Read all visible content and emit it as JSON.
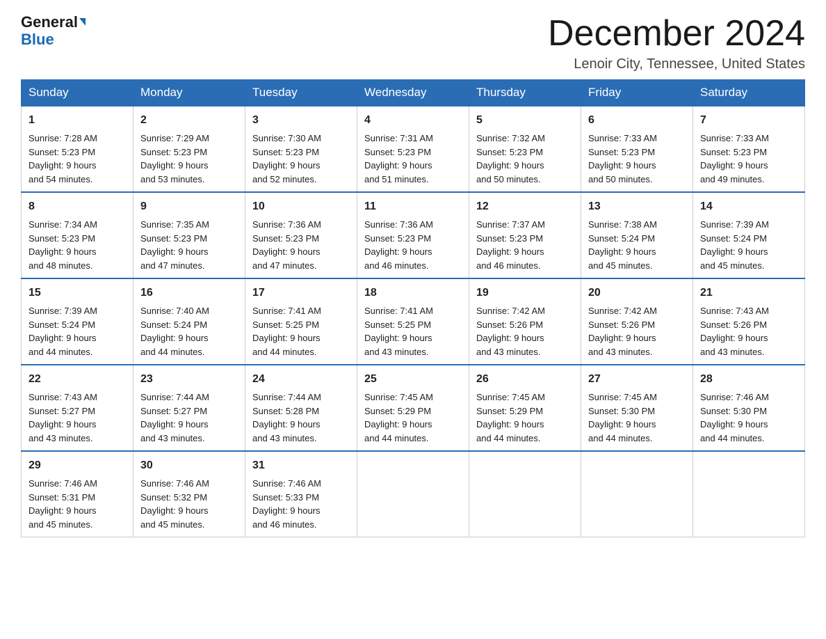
{
  "header": {
    "logo_line1": "General",
    "logo_line2": "Blue",
    "month_title": "December 2024",
    "location": "Lenoir City, Tennessee, United States"
  },
  "weekdays": [
    "Sunday",
    "Monday",
    "Tuesday",
    "Wednesday",
    "Thursday",
    "Friday",
    "Saturday"
  ],
  "weeks": [
    [
      {
        "day": "1",
        "sunrise": "7:28 AM",
        "sunset": "5:23 PM",
        "daylight": "9 hours and 54 minutes."
      },
      {
        "day": "2",
        "sunrise": "7:29 AM",
        "sunset": "5:23 PM",
        "daylight": "9 hours and 53 minutes."
      },
      {
        "day": "3",
        "sunrise": "7:30 AM",
        "sunset": "5:23 PM",
        "daylight": "9 hours and 52 minutes."
      },
      {
        "day": "4",
        "sunrise": "7:31 AM",
        "sunset": "5:23 PM",
        "daylight": "9 hours and 51 minutes."
      },
      {
        "day": "5",
        "sunrise": "7:32 AM",
        "sunset": "5:23 PM",
        "daylight": "9 hours and 50 minutes."
      },
      {
        "day": "6",
        "sunrise": "7:33 AM",
        "sunset": "5:23 PM",
        "daylight": "9 hours and 50 minutes."
      },
      {
        "day": "7",
        "sunrise": "7:33 AM",
        "sunset": "5:23 PM",
        "daylight": "9 hours and 49 minutes."
      }
    ],
    [
      {
        "day": "8",
        "sunrise": "7:34 AM",
        "sunset": "5:23 PM",
        "daylight": "9 hours and 48 minutes."
      },
      {
        "day": "9",
        "sunrise": "7:35 AM",
        "sunset": "5:23 PM",
        "daylight": "9 hours and 47 minutes."
      },
      {
        "day": "10",
        "sunrise": "7:36 AM",
        "sunset": "5:23 PM",
        "daylight": "9 hours and 47 minutes."
      },
      {
        "day": "11",
        "sunrise": "7:36 AM",
        "sunset": "5:23 PM",
        "daylight": "9 hours and 46 minutes."
      },
      {
        "day": "12",
        "sunrise": "7:37 AM",
        "sunset": "5:23 PM",
        "daylight": "9 hours and 46 minutes."
      },
      {
        "day": "13",
        "sunrise": "7:38 AM",
        "sunset": "5:24 PM",
        "daylight": "9 hours and 45 minutes."
      },
      {
        "day": "14",
        "sunrise": "7:39 AM",
        "sunset": "5:24 PM",
        "daylight": "9 hours and 45 minutes."
      }
    ],
    [
      {
        "day": "15",
        "sunrise": "7:39 AM",
        "sunset": "5:24 PM",
        "daylight": "9 hours and 44 minutes."
      },
      {
        "day": "16",
        "sunrise": "7:40 AM",
        "sunset": "5:24 PM",
        "daylight": "9 hours and 44 minutes."
      },
      {
        "day": "17",
        "sunrise": "7:41 AM",
        "sunset": "5:25 PM",
        "daylight": "9 hours and 44 minutes."
      },
      {
        "day": "18",
        "sunrise": "7:41 AM",
        "sunset": "5:25 PM",
        "daylight": "9 hours and 43 minutes."
      },
      {
        "day": "19",
        "sunrise": "7:42 AM",
        "sunset": "5:26 PM",
        "daylight": "9 hours and 43 minutes."
      },
      {
        "day": "20",
        "sunrise": "7:42 AM",
        "sunset": "5:26 PM",
        "daylight": "9 hours and 43 minutes."
      },
      {
        "day": "21",
        "sunrise": "7:43 AM",
        "sunset": "5:26 PM",
        "daylight": "9 hours and 43 minutes."
      }
    ],
    [
      {
        "day": "22",
        "sunrise": "7:43 AM",
        "sunset": "5:27 PM",
        "daylight": "9 hours and 43 minutes."
      },
      {
        "day": "23",
        "sunrise": "7:44 AM",
        "sunset": "5:27 PM",
        "daylight": "9 hours and 43 minutes."
      },
      {
        "day": "24",
        "sunrise": "7:44 AM",
        "sunset": "5:28 PM",
        "daylight": "9 hours and 43 minutes."
      },
      {
        "day": "25",
        "sunrise": "7:45 AM",
        "sunset": "5:29 PM",
        "daylight": "9 hours and 44 minutes."
      },
      {
        "day": "26",
        "sunrise": "7:45 AM",
        "sunset": "5:29 PM",
        "daylight": "9 hours and 44 minutes."
      },
      {
        "day": "27",
        "sunrise": "7:45 AM",
        "sunset": "5:30 PM",
        "daylight": "9 hours and 44 minutes."
      },
      {
        "day": "28",
        "sunrise": "7:46 AM",
        "sunset": "5:30 PM",
        "daylight": "9 hours and 44 minutes."
      }
    ],
    [
      {
        "day": "29",
        "sunrise": "7:46 AM",
        "sunset": "5:31 PM",
        "daylight": "9 hours and 45 minutes."
      },
      {
        "day": "30",
        "sunrise": "7:46 AM",
        "sunset": "5:32 PM",
        "daylight": "9 hours and 45 minutes."
      },
      {
        "day": "31",
        "sunrise": "7:46 AM",
        "sunset": "5:33 PM",
        "daylight": "9 hours and 46 minutes."
      },
      null,
      null,
      null,
      null
    ]
  ]
}
